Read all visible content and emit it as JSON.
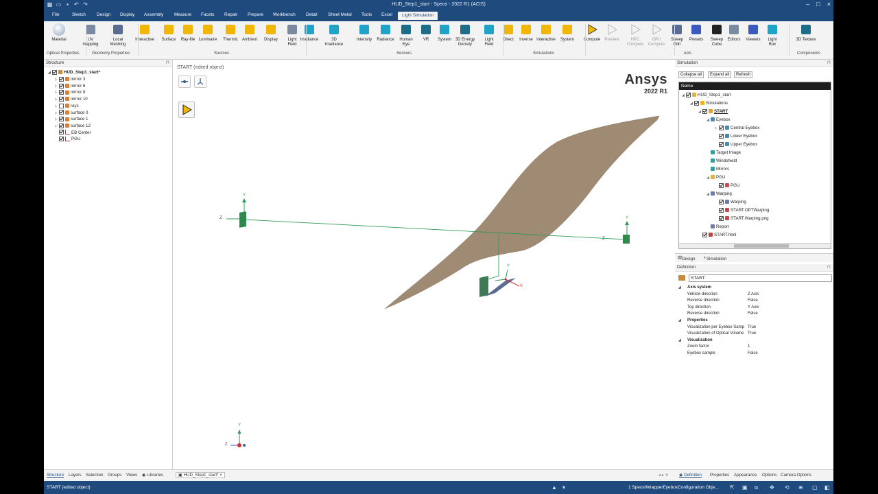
{
  "window": {
    "title": "HUD_Step1_start - Speos - 2022 R1 (ACIS)",
    "menu_tabs": [
      "File",
      "Sketch",
      "Design",
      "Display",
      "Assembly",
      "Measure",
      "Facets",
      "Repair",
      "Prepare",
      "Workbench",
      "Detail",
      "Sheet Metal",
      "Tools",
      "Excel",
      "Light Simulation"
    ],
    "active_tab": "Light Simulation"
  },
  "ribbon": {
    "buttons": [
      {
        "label": "Material",
        "icon": "material-sphere-icon"
      },
      {
        "label": "UV mapping",
        "icon": "uv-mapping-icon"
      },
      {
        "label": "Local\nMeshing",
        "icon": "local-meshing-icon"
      },
      {
        "label": "Interactive",
        "icon": "interactive-source-icon"
      },
      {
        "label": "Surface",
        "icon": "surface-source-icon"
      },
      {
        "label": "Ray-file",
        "icon": "ray-file-icon"
      },
      {
        "label": "Luminaire",
        "icon": "luminaire-icon"
      },
      {
        "label": "Thermic",
        "icon": "thermic-icon"
      },
      {
        "label": "Ambient",
        "icon": "ambient-icon"
      },
      {
        "label": "Display",
        "icon": "display-source-icon"
      },
      {
        "label": "Light\nField",
        "icon": "light-field-source-icon"
      },
      {
        "label": "Irradiance",
        "icon": "irradiance-sensor-icon"
      },
      {
        "label": "3D Irradiance",
        "icon": "3d-irradiance-icon"
      },
      {
        "label": "Intensity",
        "icon": "intensity-sensor-icon"
      },
      {
        "label": "Radiance",
        "icon": "radiance-sensor-icon"
      },
      {
        "label": "Human\nEye",
        "icon": "human-eye-icon"
      },
      {
        "label": "VR",
        "icon": "vr-sensor-icon"
      },
      {
        "label": "System",
        "icon": "system-sensor-icon"
      },
      {
        "label": "3D Energy\nDensity",
        "icon": "3d-energy-density-icon"
      },
      {
        "label": "Light\nField",
        "icon": "light-field-sensor-icon"
      },
      {
        "label": "Direct",
        "icon": "direct-simulation-icon"
      },
      {
        "label": "Inverse",
        "icon": "inverse-simulation-icon"
      },
      {
        "label": "Interactive",
        "icon": "interactive-simulation-icon"
      },
      {
        "label": "System",
        "icon": "system-simulation-icon"
      },
      {
        "label": "Compute",
        "icon": "compute-icon"
      },
      {
        "label": "Preview",
        "icon": "preview-icon"
      },
      {
        "label": "HPC\nCompute",
        "icon": "hpc-compute-icon"
      },
      {
        "label": "GPU\nCompute",
        "icon": "gpu-compute-icon"
      },
      {
        "label": "Sweep\nEdit",
        "icon": "sweep-edit-icon"
      },
      {
        "label": "Presets",
        "icon": "presets-icon"
      },
      {
        "label": "Sweep\nCube",
        "icon": "sweep-cube-icon"
      },
      {
        "label": "Editors",
        "icon": "editors-icon"
      },
      {
        "label": "Viewers",
        "icon": "viewers-icon"
      },
      {
        "label": "Light\nBox",
        "icon": "light-box-icon"
      },
      {
        "label": "3D Texture",
        "icon": "3d-texture-icon"
      }
    ],
    "groups": [
      "Optical Properties",
      "Geometry Properties",
      "Sources",
      "Sensors",
      "Simulations",
      "ools",
      "Components"
    ]
  },
  "structure": {
    "title": "Structure",
    "root": "HUD_Step1_start*",
    "items": [
      {
        "label": "mirror 3",
        "checked": true
      },
      {
        "label": "mirror 6",
        "checked": true
      },
      {
        "label": "mirror 8",
        "checked": true
      },
      {
        "label": "mirror 10",
        "checked": true
      },
      {
        "label": "rays",
        "checked": false
      },
      {
        "label": "surface 0",
        "checked": true
      },
      {
        "label": "surface 1",
        "checked": true
      },
      {
        "label": "surface 12",
        "checked": true
      },
      {
        "label": "EB Center",
        "checked": true
      },
      {
        "label": "PGU",
        "checked": true
      }
    ]
  },
  "viewport": {
    "label": "START (edited object)",
    "brand_name": "Ansys",
    "brand_version": "2022 R1",
    "axis_labels": {
      "y": "Y",
      "z": "Z",
      "x": "X"
    }
  },
  "simulation": {
    "title": "Simulation",
    "buttons": [
      "Collapse all",
      "Expand all",
      "Refresh"
    ],
    "column": "Name",
    "tree": [
      {
        "label": "HUD_Step1_start",
        "level": 0,
        "checked": true,
        "icon": "folder-icon"
      },
      {
        "label": "Simulations",
        "level": 1,
        "checked": true,
        "icon": "play-icon"
      },
      {
        "label": "START",
        "level": 2,
        "checked": true,
        "icon": "simulation-icon",
        "bold": true
      },
      {
        "label": "Eyebox",
        "level": 3,
        "checked": null,
        "icon": "eyebox-icon"
      },
      {
        "label": "Central Eyebox",
        "level": 4,
        "checked": true,
        "icon": "eyebox-icon"
      },
      {
        "label": "Lower Eyebox",
        "level": 4,
        "checked": true,
        "icon": "eyebox-icon"
      },
      {
        "label": "Upper Eyebox",
        "level": 4,
        "checked": true,
        "icon": "eyebox-icon"
      },
      {
        "label": "Target Image",
        "level": 3,
        "checked": null,
        "icon": "target-image-icon"
      },
      {
        "label": "Windshield",
        "level": 3,
        "checked": null,
        "icon": "windshield-icon"
      },
      {
        "label": "Mirrors",
        "level": 3,
        "checked": null,
        "icon": "mirrors-icon"
      },
      {
        "label": "PGU",
        "level": 3,
        "checked": null,
        "icon": "folder-icon"
      },
      {
        "label": "PGU",
        "level": 4,
        "checked": true,
        "icon": "pgu-icon"
      },
      {
        "label": "Warping",
        "level": 3,
        "checked": null,
        "icon": "warping-icon"
      },
      {
        "label": "Warping",
        "level": 4,
        "checked": true,
        "icon": "warping-icon"
      },
      {
        "label": "START.OPTWarping",
        "level": 4,
        "checked": true,
        "icon": "file-icon"
      },
      {
        "label": "START.Warping.png",
        "level": 4,
        "checked": true,
        "icon": "file-icon"
      },
      {
        "label": "Report",
        "level": 3,
        "checked": null,
        "icon": "report-icon"
      },
      {
        "label": "START.html",
        "level": 2,
        "checked": true,
        "icon": "html-file-icon"
      }
    ],
    "tabs": [
      "Design",
      "Simulation"
    ]
  },
  "definition": {
    "title": "Definition",
    "name_value": "START",
    "rows": [
      {
        "type": "cat",
        "key": "Axis system"
      },
      {
        "type": "prop",
        "key": "Vehicle direction",
        "value": "Z Axis"
      },
      {
        "type": "prop",
        "key": "Reverse direction",
        "value": "False"
      },
      {
        "type": "prop",
        "key": "Top direction",
        "value": "Y Axis"
      },
      {
        "type": "prop",
        "key": "Reverse direction",
        "value": "False"
      },
      {
        "type": "cat",
        "key": "Properties"
      },
      {
        "type": "prop",
        "key": "Visualization per Eyebox Samp",
        "value": "True"
      },
      {
        "type": "prop",
        "key": "Visualization of Optical Volume",
        "value": "True"
      },
      {
        "type": "cat",
        "key": "Visualization"
      },
      {
        "type": "prop",
        "key": "Zoom factor",
        "value": "1"
      },
      {
        "type": "prop",
        "key": "Eyebox sample",
        "value": "False"
      }
    ]
  },
  "bottom_tabs": {
    "left": [
      "Structure",
      "Layers",
      "Selection",
      "Groups",
      "Views",
      "Libraries"
    ],
    "doc_tab": "HUD_Step1_start*",
    "right": [
      "Definition",
      "Properties",
      "Appearance",
      "Options",
      "Camera Options"
    ]
  },
  "status": {
    "left": "START (edited object)",
    "right": "1 Speos\\WrapperEyeboxConfiguration Obje..."
  },
  "colors": {
    "accent": "#1e4a7e",
    "surface": "#9f8a73",
    "axis_green": "#2e9a55"
  }
}
